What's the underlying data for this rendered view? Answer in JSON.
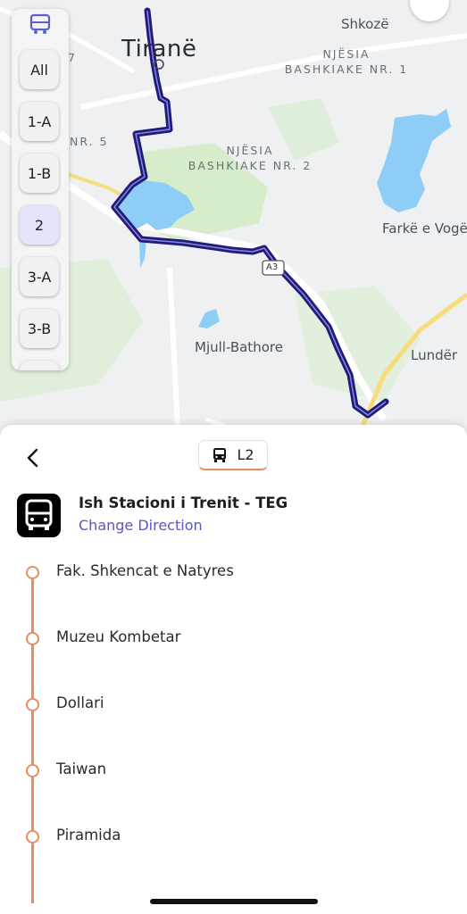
{
  "map": {
    "city_label": "Tiranë",
    "place_labels": {
      "shkoze": "Shkozë",
      "njesia1": "NJËSIA BASHKIAKE NR. 1",
      "njesia2": "NJËSIA BASHKIAKE NR. 2",
      "nr5": "NR. 5",
      "nr7": "7",
      "farke": "Farkë e Vogël",
      "mjull": "Mjull-Bathore",
      "lunder": "Lundër",
      "road_shield": "A3"
    },
    "route_color": "#1f1b7a",
    "water_color": "#8ecdf5",
    "park_color": "#d4ecc9"
  },
  "route_selector": {
    "icon": "bus-icon",
    "items": [
      "All",
      "1-A",
      "1-B",
      "2",
      "3-A",
      "3-B"
    ],
    "active": "2"
  },
  "sheet": {
    "back_icon": "chevron-left-icon",
    "line_badge": "L2",
    "line_icon": "bus-icon",
    "stop_title": "Ish Stacioni i Trenit - TEG",
    "change_direction": "Change Direction",
    "accent_color": "#ec8a60",
    "stops": [
      "Fak. Shkencat e Natyres",
      "Muzeu Kombetar",
      "Dollari",
      "Taiwan",
      "Piramida"
    ]
  }
}
